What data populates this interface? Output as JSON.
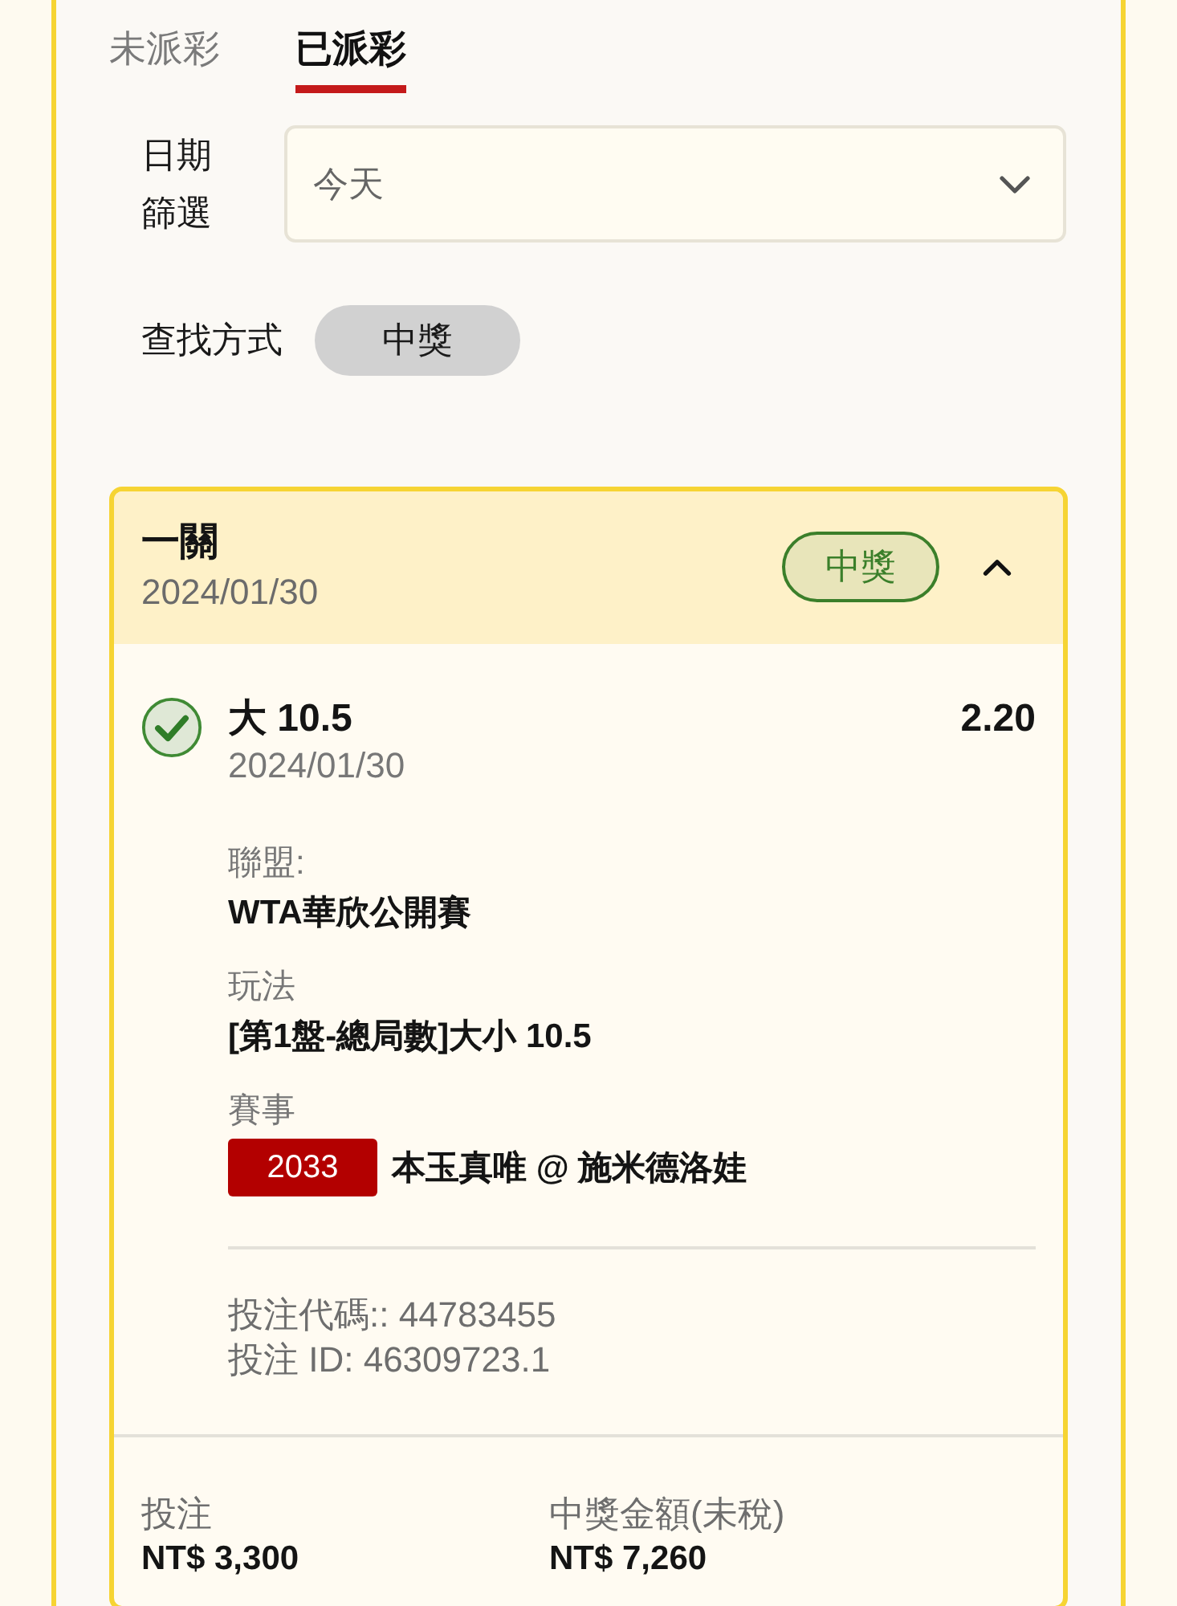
{
  "tabs": [
    {
      "label": "未派彩",
      "selected": false
    },
    {
      "label": "已派彩",
      "selected": true
    }
  ],
  "date_filter": {
    "label": "日期篩選",
    "value": "今天"
  },
  "search_by": {
    "label": "查找方式",
    "option": "中獎"
  },
  "bet_card": {
    "title": "一關",
    "date": "2024/01/30",
    "status": {
      "label": "中獎",
      "kind": "won"
    },
    "expanded": true,
    "selection": {
      "won": true,
      "name": "大 10.5",
      "odds": "2.20",
      "date": "2024/01/30",
      "details": [
        {
          "label": "聯盟:",
          "value": "WTA華欣公開賽"
        },
        {
          "label": "玩法",
          "value": "[第1盤-總局數]大小 10.5"
        },
        {
          "label": "賽事",
          "event_code": "2033",
          "value": "本玉真唯 @ 施米德洛娃"
        }
      ],
      "bet_code": "投注代碼:: 44783455",
      "bet_id": "投注 ID: 46309723.1"
    },
    "totals": [
      {
        "label": "投注",
        "value": "NT$ 3,300"
      },
      {
        "label": "中獎金額(未稅)",
        "value": "NT$ 7,260"
      }
    ]
  }
}
